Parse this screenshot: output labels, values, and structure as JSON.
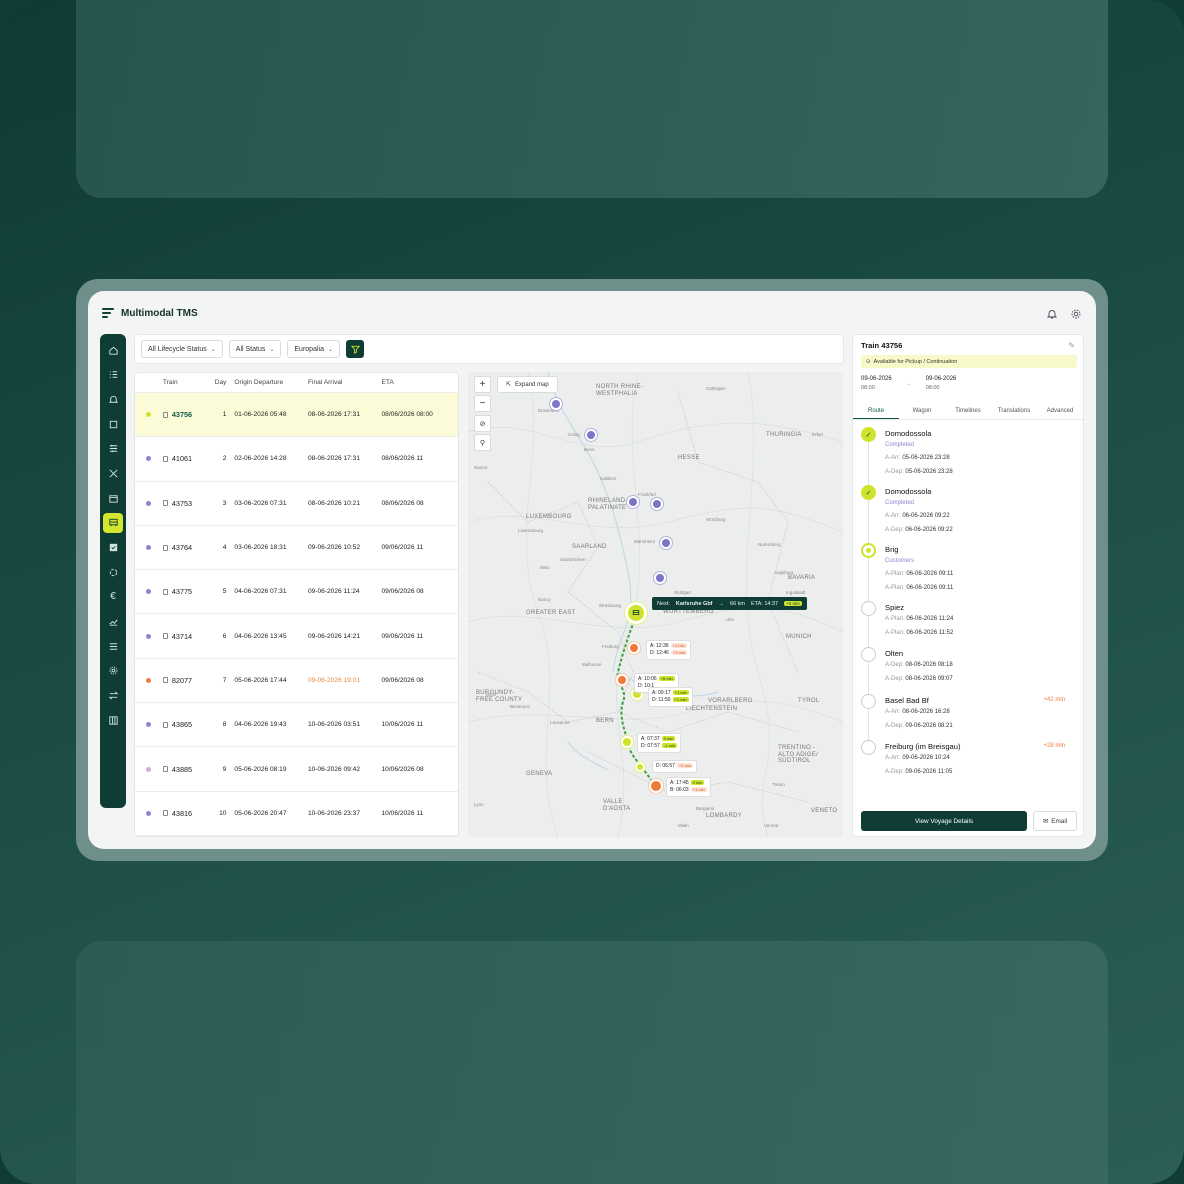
{
  "app": {
    "title": "Multimodal TMS"
  },
  "header": {
    "icons": [
      "bell-icon",
      "gear-icon"
    ]
  },
  "sidebar": {
    "items": [
      {
        "name": "home-icon"
      },
      {
        "name": "list-checks-icon"
      },
      {
        "name": "bell-icon"
      },
      {
        "name": "frame-icon"
      },
      {
        "name": "sliders-icon"
      },
      {
        "name": "network-icon"
      },
      {
        "name": "calendar-icon"
      },
      {
        "name": "train-icon",
        "active": true
      },
      {
        "name": "checkbox-icon"
      },
      {
        "name": "link-icon"
      },
      {
        "name": "euro-icon"
      },
      {
        "name": "chart-line-icon"
      },
      {
        "name": "menu-icon"
      },
      {
        "name": "gear-icon"
      },
      {
        "name": "transfer-icon"
      },
      {
        "name": "columns-icon"
      }
    ]
  },
  "filters": {
    "lifecycle": "All Lifecycle Status",
    "status": "All Status",
    "operator": "Europalia"
  },
  "table": {
    "columns": [
      "Train",
      "Day",
      "Origin Departure",
      "Final Arrival",
      "ETA"
    ],
    "rows": [
      {
        "dot": "#cfe32c",
        "train": "43756",
        "day": "1",
        "origin": "01-06-2026 05:48",
        "final": "08-06-2026 17:31",
        "eta": "08/06/2026 08:00",
        "late": false
      },
      {
        "dot": "#8a86cf",
        "train": "41061",
        "day": "2",
        "origin": "02-06-2026 14:28",
        "final": "08-06-2026 17:31",
        "eta": "08/06/2026 11",
        "late": false
      },
      {
        "dot": "#8a86cf",
        "train": "43753",
        "day": "3",
        "origin": "03-06-2026 07:31",
        "final": "08-06-2026 10:21",
        "eta": "08/06/2026 08",
        "late": false
      },
      {
        "dot": "#8a86cf",
        "train": "43764",
        "day": "4",
        "origin": "03-06-2026 18:31",
        "final": "09-06-2026 10:52",
        "eta": "09/06/2026 11",
        "late": false
      },
      {
        "dot": "#8a86cf",
        "train": "43775",
        "day": "5",
        "origin": "04-06-2026 07:31",
        "final": "09-06-2026 11:24",
        "eta": "09/06/2026 08",
        "late": false
      },
      {
        "dot": "#8a86cf",
        "train": "43714",
        "day": "6",
        "origin": "04-06-2026 13:45",
        "final": "09-06-2026 14:21",
        "eta": "09/06/2026 11",
        "late": false
      },
      {
        "dot": "#ef7a3c",
        "train": "82077",
        "day": "7",
        "origin": "05-06-2026 17:44",
        "final": "09-06-2026 19:01",
        "eta": "09/06/2026 08",
        "late": true
      },
      {
        "dot": "#8a86cf",
        "train": "43865",
        "day": "8",
        "origin": "04-06-2026 19:43",
        "final": "10-06-2026 03:51",
        "eta": "10/06/2026 11",
        "late": false
      },
      {
        "dot": "#d9a6df",
        "train": "43885",
        "day": "9",
        "origin": "05-06-2026 08:19",
        "final": "10-06-2026 09:42",
        "eta": "10/06/2026 08",
        "late": false
      },
      {
        "dot": "#8a86cf",
        "train": "43816",
        "day": "10",
        "origin": "05-06-2026 20:47",
        "final": "10-06-2026 23:37",
        "eta": "10/06/2026 11",
        "late": false
      }
    ]
  },
  "map": {
    "expand_label": "Expand map",
    "regions": [
      {
        "text": "NORTH RHINE-\nWESTPHALIA"
      },
      {
        "text": "THURINGIA"
      },
      {
        "text": "HESSE"
      },
      {
        "text": "RHINELAND-\nPALATINATE"
      },
      {
        "text": "LUXEMBOURG"
      },
      {
        "text": "SAARLAND"
      },
      {
        "text": "BAVARIA"
      },
      {
        "text": "GREATER EAST"
      },
      {
        "text": "WÜRTTEMBERG"
      },
      {
        "text": "MUNICH"
      },
      {
        "text": "BURGUNDY-\nFREE COUNTY"
      },
      {
        "text": "VORARLBERG"
      },
      {
        "text": "LIECHTENSTEIN"
      },
      {
        "text": "TYROL"
      },
      {
        "text": "TRENTINO -\nALTO ADIGE/\nSÜDTIROL"
      },
      {
        "text": "VALLE\nD'AOSTA"
      },
      {
        "text": "LOMBARDY"
      },
      {
        "text": "VENETO"
      },
      {
        "text": "BERN"
      },
      {
        "text": "GENEVA"
      }
    ],
    "cities": [
      "Göttingen",
      "Colog",
      "Bonn",
      "Koblenz",
      "Frankfurt",
      "Würzburg",
      "Mannheim",
      "Nuremberg",
      "Stuttgart",
      "Strasbourg",
      "Ulm",
      "Freiburg",
      "Mulhouse",
      "Dijon",
      "Lausanne",
      "Lyon",
      "Milan",
      "Bergamo",
      "Verona",
      "Trento",
      "Namur",
      "Luxembourg",
      "Metz",
      "Nancy",
      "Saarbrücken",
      "Augsburg",
      "Ingolstadt",
      "Erfurt",
      "Düsseldorf",
      "Besançon"
    ],
    "next_tip": {
      "prefix": "Next:",
      "station": "Karlsruhe Gbf",
      "distance": "66 km",
      "eta": "ETA: 14:37",
      "badge": "+0 min"
    },
    "stops": [
      {
        "a": "A: 12:36",
        "a_tag": "+4 min",
        "d": "D: 12:46",
        "d_tag": "+3 min"
      },
      {
        "a": "A: 10:06",
        "a_tag": "+6 min",
        "d": "D: 10:1",
        "d_tag": ""
      },
      {
        "a": "A: 09:17",
        "a_tag": "+1 min",
        "d": "D: 11:50",
        "d_tag": "+1 min"
      },
      {
        "a": "A: 07:37",
        "a_tag": "0 min",
        "d": "D: 07:57",
        "d_tag": "-1 min"
      },
      {
        "a": "D: 06:57",
        "a_tag": "+2 min",
        "d": "",
        "d_tag": ""
      },
      {
        "a": "A: 17:45",
        "a_tag": "0 min",
        "d": "B: 06:03",
        "d_tag": "+1 min"
      }
    ]
  },
  "detail": {
    "title": "Train 43756",
    "availability": "Available for Pickup / Continuation",
    "dates": {
      "from": "09-06-2026",
      "from_time": "08:00",
      "to": "09-06-2026",
      "to_time": "08:00"
    },
    "tabs": [
      "Route",
      "Wagon",
      "Timelines",
      "Translations",
      "Advanced"
    ],
    "stops": [
      {
        "name": "Domodossola",
        "status": "Completed",
        "state": "done",
        "delay": "",
        "lines": [
          [
            "A-Arr:",
            "05-06-2026 23:28"
          ],
          [
            "A-Dep:",
            "05-06-2026 23:28"
          ]
        ]
      },
      {
        "name": "Domodossola",
        "status": "Completed",
        "state": "done",
        "delay": "",
        "lines": [
          [
            "A-Arr:",
            "06-06-2026 09:22"
          ],
          [
            "A-Dep:",
            "06-06-2026 09:22"
          ]
        ]
      },
      {
        "name": "Brig",
        "status": "Customers",
        "state": "current",
        "delay": "",
        "lines": [
          [
            "A-Plan:",
            "06-06-2026 09:11"
          ],
          [
            "A-Plan:",
            "06-06-2026 09:11"
          ]
        ]
      },
      {
        "name": "Spiez",
        "status": "",
        "state": "pending",
        "delay": "",
        "lines": [
          [
            "A-Plan:",
            "06-06-2026 11:24"
          ],
          [
            "A-Plan:",
            "06-06-2026 11:52"
          ]
        ]
      },
      {
        "name": "Olten",
        "status": "",
        "state": "pending",
        "delay": "",
        "lines": [
          [
            "A-Dep:",
            "08-06-2026 08:18"
          ],
          [
            "A-Dep:",
            "08-06-2026 09:07"
          ]
        ]
      },
      {
        "name": "Basel Bad Bf",
        "status": "",
        "state": "pending",
        "delay": "+42 min",
        "lines": [
          [
            "A-Arr:",
            "08-06-2026 16:28"
          ],
          [
            "A-Dep:",
            "09-06-2026 08:21"
          ]
        ]
      },
      {
        "name": "Freiburg (im Breisgau)",
        "status": "",
        "state": "pending",
        "delay": "+28 min",
        "lines": [
          [
            "A-Arr:",
            "09-06-2026 10:24"
          ],
          [
            "A-Dep:",
            "09-06-2026 11:05"
          ]
        ]
      }
    ],
    "primary_button": "View Voyage Details",
    "secondary_button": "Email"
  }
}
